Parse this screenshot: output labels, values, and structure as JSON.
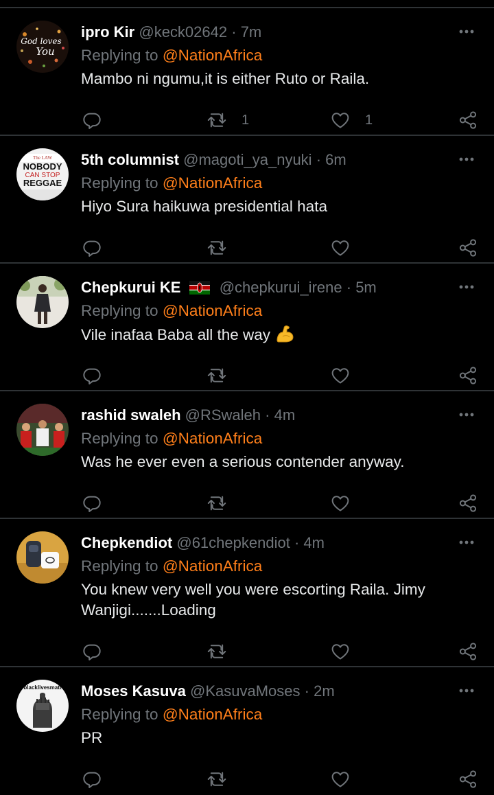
{
  "tweets": [
    {
      "name": "ipro Kir",
      "handle": "@keck02642",
      "separator": "·",
      "time": "7m",
      "replying_prefix": "Replying to",
      "replying_to": "@NationAfrica",
      "text": "Mambo ni ngumu,it is either Ruto or Raila.",
      "retweets": "1",
      "likes": "1",
      "avatar_text": [
        "God loves",
        "You"
      ]
    },
    {
      "name": "5th columnist",
      "handle": "@magoti_ya_nyuki",
      "separator": "·",
      "time": "6m",
      "replying_prefix": "Replying to",
      "replying_to": "@NationAfrica",
      "text": "Hiyo Sura haikuwa presidential hata",
      "retweets": "",
      "likes": "",
      "avatar_text": [
        "The LAW",
        "NOBODY",
        "CAN STOP",
        "REGGAE"
      ]
    },
    {
      "name": "Chepkurui KE",
      "handle": "@chepkurui_irene",
      "separator": "·",
      "time": "5m",
      "replying_prefix": "Replying to",
      "replying_to": "@NationAfrica",
      "text": "Vile inafaa Baba all the way",
      "retweets": "",
      "likes": ""
    },
    {
      "name": "rashid swaleh",
      "handle": "@RSwaleh",
      "separator": "·",
      "time": "4m",
      "replying_prefix": "Replying to",
      "replying_to": "@NationAfrica",
      "text": "Was he ever even a serious contender anyway.",
      "retweets": "",
      "likes": ""
    },
    {
      "name": "Chepkendiot",
      "handle": "@61chepkendiot",
      "separator": "·",
      "time": "4m",
      "replying_prefix": "Replying to",
      "replying_to": "@NationAfrica",
      "text": "You knew very well you were escorting Raila. Jimy Wanjigi.......Loading",
      "retweets": "",
      "likes": ""
    },
    {
      "name": "Moses Kasuva",
      "handle": "@KasuvaMoses",
      "separator": "·",
      "time": "2m",
      "replying_prefix": "Replying to",
      "replying_to": "@NationAfrica",
      "text": "PR",
      "retweets": "",
      "likes": "",
      "avatar_text": [
        "blacklivesmatt"
      ]
    }
  ],
  "colors": {
    "background": "#000000",
    "divider": "#2f3336",
    "mention": "#ff7f1a",
    "muted": "#71767b",
    "text": "#e7e9ea"
  },
  "icons": {
    "more": "more-icon",
    "reply": "reply-icon",
    "retweet": "retweet-icon",
    "like": "heart-icon",
    "share": "share-icon",
    "flag": "kenya-flag-icon",
    "emoji": "flexed-biceps-emoji-icon"
  }
}
